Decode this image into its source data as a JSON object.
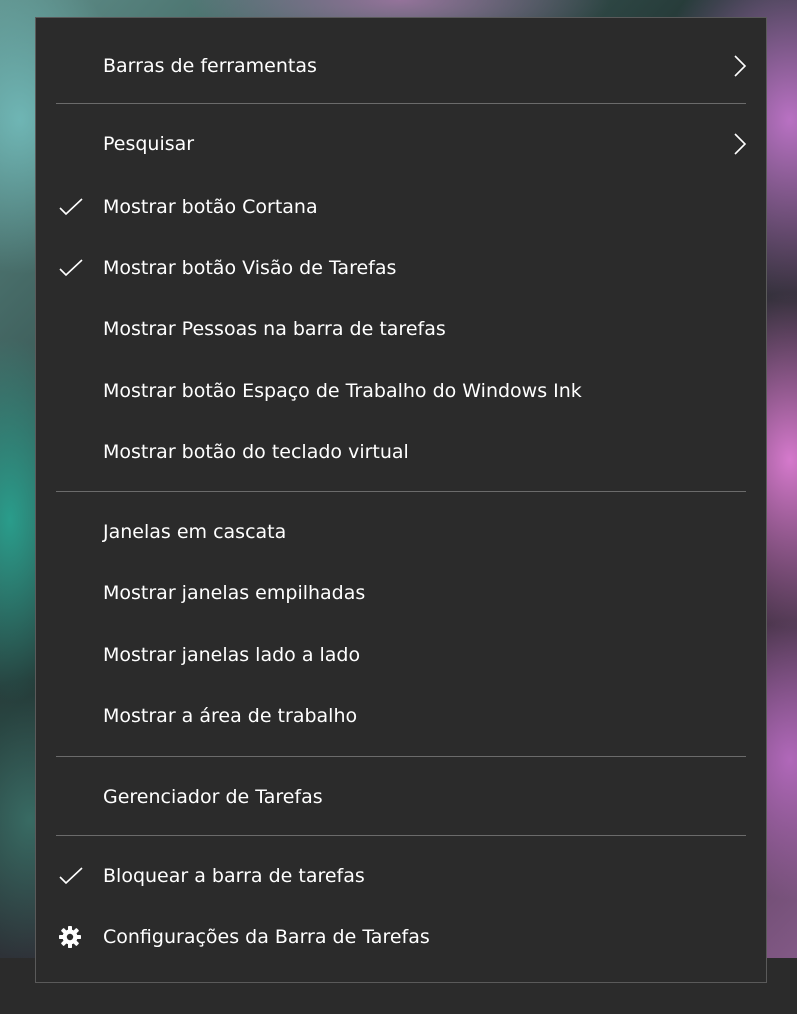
{
  "menu": {
    "toolbars": {
      "label": "Barras de ferramentas",
      "icon": "chevron-right-icon"
    },
    "search": {
      "label": "Pesquisar",
      "icon": "chevron-right-icon"
    },
    "show_cortana": {
      "label": "Mostrar botão Cortana",
      "checked": true
    },
    "show_task_view": {
      "label": "Mostrar botão Visão de Tarefas",
      "checked": true
    },
    "show_people": {
      "label": "Mostrar Pessoas na barra de tarefas",
      "checked": false
    },
    "show_ink_workspace": {
      "label": "Mostrar botão Espaço de Trabalho do Windows Ink",
      "checked": false
    },
    "show_touch_keyboard": {
      "label": "Mostrar botão do teclado virtual",
      "checked": false
    },
    "cascade_windows": {
      "label": "Janelas em cascata"
    },
    "stacked_windows": {
      "label": "Mostrar janelas empilhadas"
    },
    "side_by_side_windows": {
      "label": "Mostrar janelas lado a lado"
    },
    "show_desktop": {
      "label": "Mostrar a área de trabalho"
    },
    "task_manager": {
      "label": "Gerenciador de Tarefas"
    },
    "lock_taskbar": {
      "label": "Bloquear a barra de tarefas",
      "checked": true
    },
    "taskbar_settings": {
      "label": "Configurações da Barra de Tarefas",
      "icon": "gear-icon"
    }
  },
  "colors": {
    "menu_background": "#2b2b2b",
    "menu_border": "#5a5a5a",
    "separator": "#6b6b6b",
    "text": "#ffffff"
  }
}
